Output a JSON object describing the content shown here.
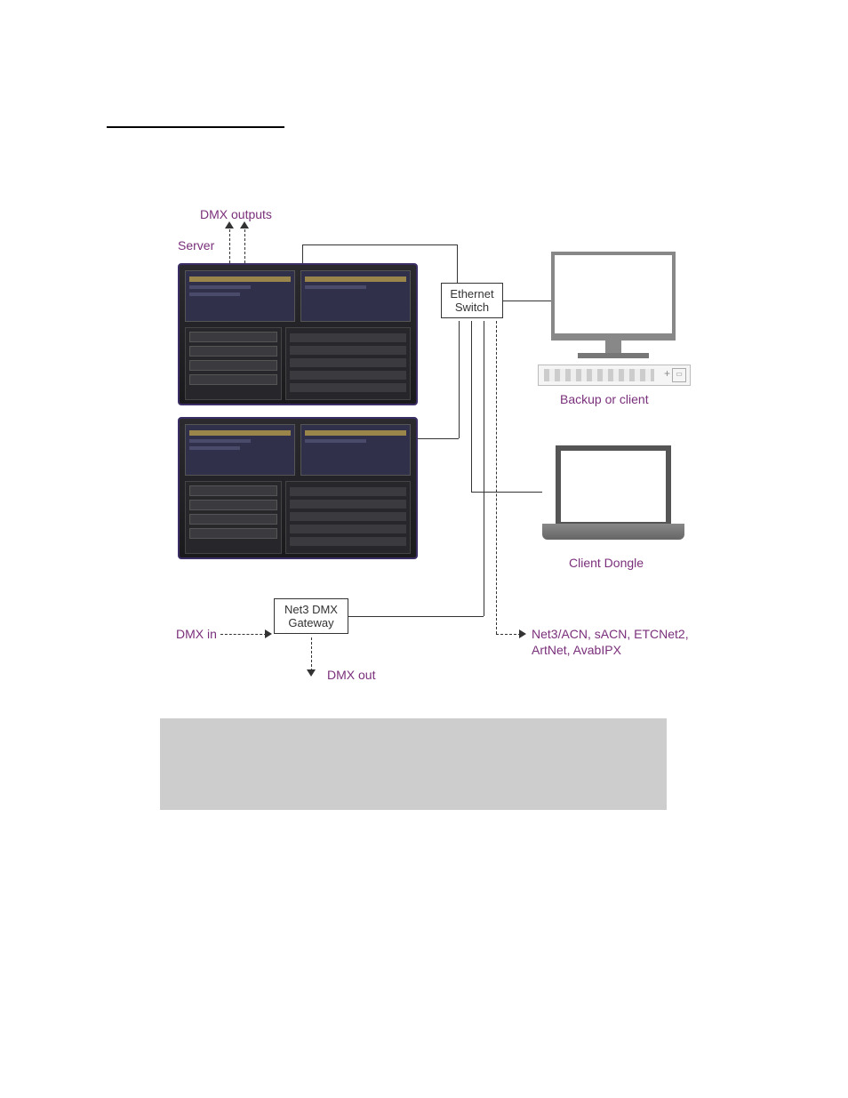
{
  "diagram": {
    "dmxOutputs": "DMX outputs",
    "server": "Server",
    "ethernetSwitch": "Ethernet\nSwitch",
    "backupOrClient": "Backup or client",
    "clientDongle": "Client Dongle",
    "net3DmxGateway": "Net3 DMX\nGateway",
    "dmxIn": "DMX in",
    "dmxOut": "DMX out",
    "protocolsLine1": "Net3/ACN, sACN, ETCNet2,",
    "protocolsLine2": "ArtNet, AvabIPX"
  }
}
